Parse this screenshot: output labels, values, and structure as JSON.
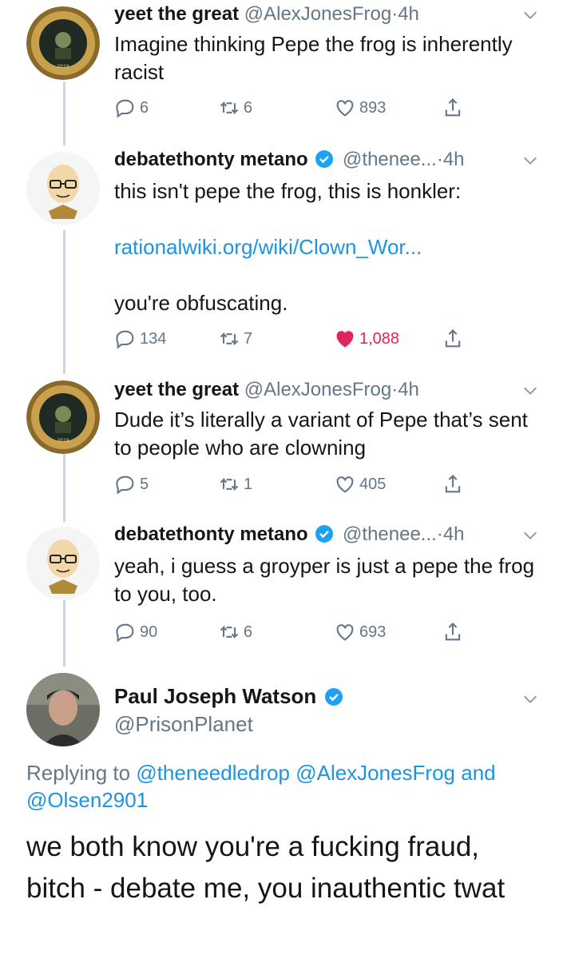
{
  "tweets": [
    {
      "name": "yeet the great",
      "handle": "@AlexJonesFrog",
      "dot": "·",
      "time": "4h",
      "text": "Imagine thinking Pepe the frog is inherently racist",
      "replies": "6",
      "retweets": "6",
      "likes": "893",
      "liked": false,
      "avatar": "frog-emblem-avatar"
    },
    {
      "name": "debatethonty metano",
      "handle": "@thenee...",
      "dot": "·",
      "time": "4h",
      "text_line1": "this isn't pepe the frog, this is honkler:",
      "link": "rationalwiki.org/wiki/Clown_Wor...",
      "text_line3": "you're obfuscating.",
      "replies": "134",
      "retweets": "7",
      "likes": "1,088",
      "liked": true,
      "verified": true,
      "avatar": "cartoon-glasses-avatar"
    },
    {
      "name": "yeet the great",
      "handle": "@AlexJonesFrog",
      "dot": "·",
      "time": "4h",
      "text": "Dude it’s literally a variant of Pepe that’s sent to people who are clowning",
      "replies": "5",
      "retweets": "1",
      "likes": "405",
      "liked": false,
      "avatar": "frog-emblem-avatar"
    },
    {
      "name": "debatethonty metano",
      "handle": "@thenee...",
      "dot": "·",
      "time": "4h",
      "text": "yeah, i guess a groyper is just a pepe the frog to you, too.",
      "replies": "90",
      "retweets": "6",
      "likes": "693",
      "liked": false,
      "verified": true,
      "avatar": "cartoon-glasses-avatar"
    }
  ],
  "main_tweet": {
    "name": "Paul Joseph Watson",
    "handle": "@PrisonPlanet",
    "verified": true,
    "replying_prefix": "Replying to",
    "mention1": "@theneedledrop",
    "mention2": "@AlexJonesFrog",
    "and_word": "and",
    "mention3": "@Olsen2901",
    "text": "we both know you're a fucking fraud, bitch - debate me, you inauthentic twat"
  },
  "colors": {
    "accent": "#1b95e0",
    "like": "#e0245e",
    "muted": "#657786",
    "verified": "#1da1f2"
  },
  "icons": [
    "reply-icon",
    "retweet-icon",
    "like-icon",
    "share-icon",
    "chevron-down-icon",
    "verified-badge-icon"
  ]
}
